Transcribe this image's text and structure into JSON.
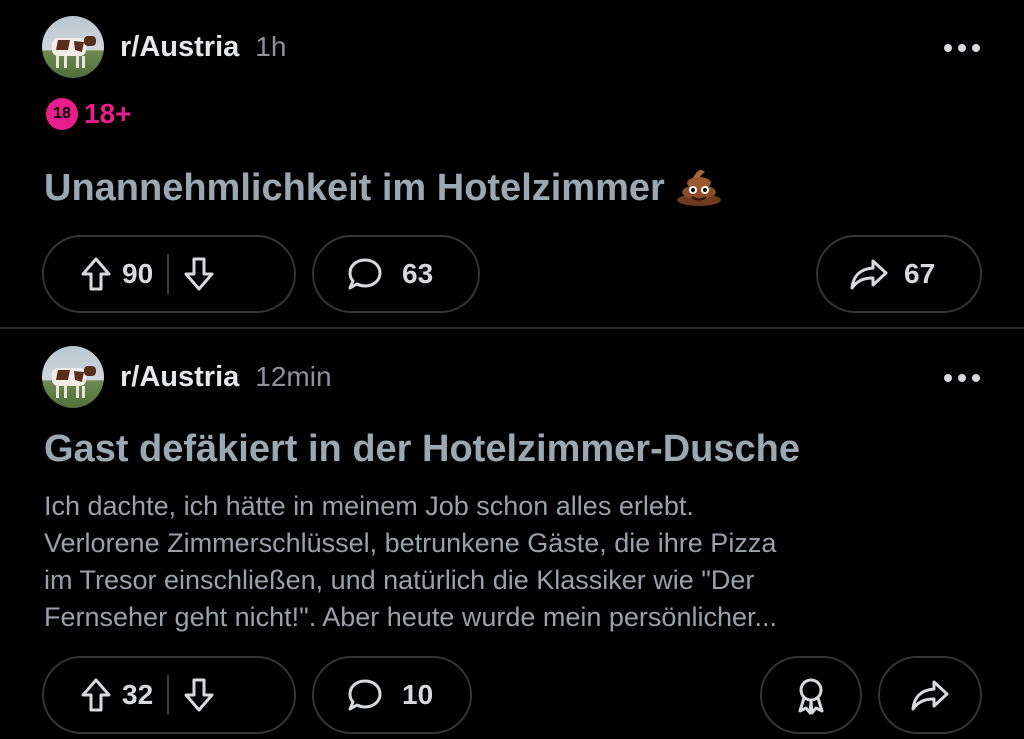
{
  "posts": [
    {
      "subreddit": "r/Austria",
      "time": "1h",
      "nsfw_badge": "18",
      "nsfw_label": "18+",
      "title": "Unannehmlichkeit im Hotelzimmer",
      "title_emoji": "pile-of-poo",
      "votes": "90",
      "comments": "63",
      "shares": "67"
    },
    {
      "subreddit": "r/Austria",
      "time": "12min",
      "title": "Gast defäkiert in der Hotelzimmer-Dusche",
      "body_lines": [
        "Ich dachte, ich hätte in meinem Job schon alles erlebt.",
        "Verlorene Zimmerschlüssel, betrunkene Gäste, die ihre Pizza",
        "im Tresor einschließen, und natürlich die Klassiker wie \"Der",
        "Fernseher geht nicht!\". Aber heute wurde mein persönlicher..."
      ],
      "votes": "32",
      "comments": "10"
    }
  ],
  "colors": {
    "background": "#000000",
    "nsfw_accent": "#e91e8c",
    "title": "#9aa8b3",
    "border": "#343536"
  },
  "icons": [
    "upvote-icon",
    "downvote-icon",
    "comment-icon",
    "share-icon",
    "award-icon",
    "more-icon"
  ]
}
